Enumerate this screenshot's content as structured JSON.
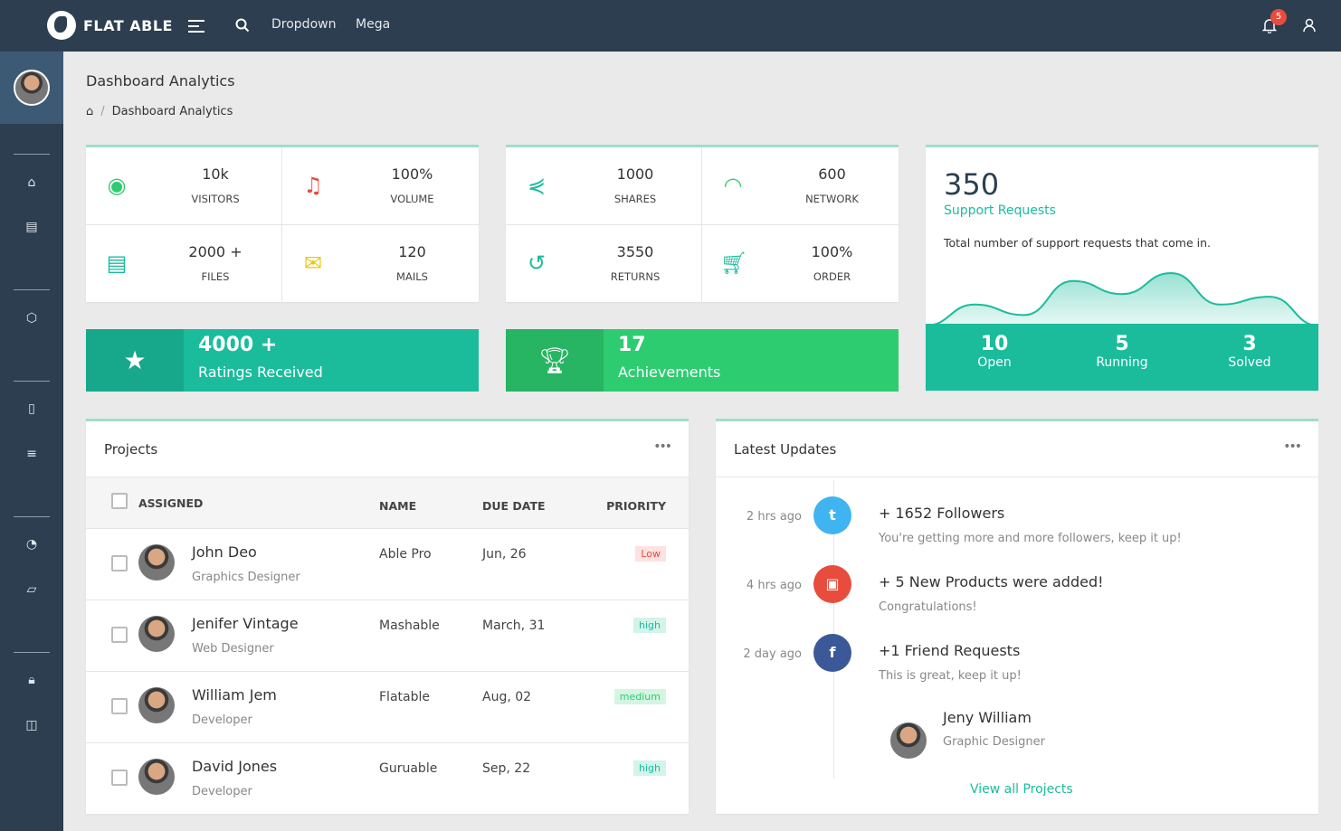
{
  "topbar": {
    "brand": "FLAT ABLE",
    "nav": [
      "Dropdown",
      "Mega"
    ],
    "notifications": "5"
  },
  "page": {
    "title": "Dashboard Analytics",
    "breadcrumb": "Dashboard Analytics"
  },
  "stats1": [
    {
      "value": "10k",
      "label": "VISITORS",
      "icon": "eye-icon",
      "color": "#2ecc71"
    },
    {
      "value": "100%",
      "label": "VOLUME",
      "icon": "music-icon",
      "color": "#e74c3c"
    },
    {
      "value": "2000 +",
      "label": "FILES",
      "icon": "file-icon",
      "color": "#1abc9c"
    },
    {
      "value": "120",
      "label": "MAILS",
      "icon": "mail-icon",
      "color": "#f1c40f"
    }
  ],
  "stats2": [
    {
      "value": "1000",
      "label": "SHARES",
      "icon": "share-icon",
      "color": "#1abc9c"
    },
    {
      "value": "600",
      "label": "NETWORK",
      "icon": "wifi-icon",
      "color": "#2ecc71"
    },
    {
      "value": "3550",
      "label": "RETURNS",
      "icon": "rotate-icon",
      "color": "#1abc9c"
    },
    {
      "value": "100%",
      "label": "ORDER",
      "icon": "cart-icon",
      "color": "#1abc9c"
    }
  ],
  "banners": [
    {
      "value": "4000 +",
      "label": "Ratings Received",
      "icon": "star-icon",
      "color": "#1abc9c",
      "dark": "#17a88b"
    },
    {
      "value": "17",
      "label": "Achievements",
      "icon": "trophy-icon",
      "color": "#2ecc71",
      "dark": "#27b463"
    }
  ],
  "support": {
    "count": "350",
    "title": "Support Requests",
    "desc": "Total number of support requests that come in.",
    "sparkline": [
      0,
      4,
      2,
      8.5,
      6,
      10,
      4,
      5.5,
      0
    ],
    "stats": [
      {
        "value": "10",
        "label": "Open"
      },
      {
        "value": "5",
        "label": "Running"
      },
      {
        "value": "3",
        "label": "Solved"
      }
    ]
  },
  "projects": {
    "title": "Projects",
    "columns": [
      "ASSIGNED",
      "NAME",
      "DUE DATE",
      "PRIORITY"
    ],
    "rows": [
      {
        "name": "John Deo",
        "role": "Graphics Designer",
        "project": "Able Pro",
        "due": "Jun, 26",
        "priority": "Low"
      },
      {
        "name": "Jenifer Vintage",
        "role": "Web Designer",
        "project": "Mashable",
        "due": "March, 31",
        "priority": "high"
      },
      {
        "name": "William Jem",
        "role": "Developer",
        "project": "Flatable",
        "due": "Aug, 02",
        "priority": "medium"
      },
      {
        "name": "David Jones",
        "role": "Developer",
        "project": "Guruable",
        "due": "Sep, 22",
        "priority": "high"
      }
    ]
  },
  "updates": {
    "title": "Latest Updates",
    "items": [
      {
        "time": "2 hrs ago",
        "title": "+ 1652 Followers",
        "sub": "You're getting more and more followers, keep it up!",
        "icon": "twitter-icon",
        "color": "#3fb4f0"
      },
      {
        "time": "4 hrs ago",
        "title": "+ 5 New Products were added!",
        "sub": "Congratulations!",
        "icon": "briefcase-icon",
        "color": "#e74c3c"
      },
      {
        "time": "2 day ago",
        "title": "+1 Friend Requests",
        "sub": "This is great, keep it up!",
        "icon": "facebook-icon",
        "color": "#3b5998"
      }
    ],
    "person": {
      "name": "Jeny William",
      "role": "Graphic Designer"
    },
    "link": "View all Projects"
  }
}
